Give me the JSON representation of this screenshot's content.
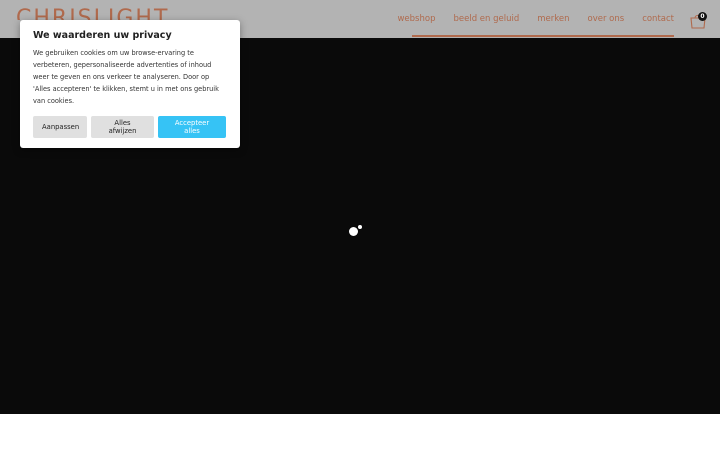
{
  "header": {
    "logo": "CHRISLIGHT",
    "nav": [
      "webshop",
      "beeld en geluid",
      "merken",
      "over ons",
      "contact"
    ],
    "cart_count": "0",
    "accent": "#b06a4d"
  },
  "consent": {
    "title": "We waarderen uw privacy",
    "text": "We gebruiken cookies om uw browse-ervaring te verbeteren, gepersonaliseerde advertenties of inhoud weer te geven en ons verkeer te analyseren. Door op 'Alles accepteren' te klikken, stemt u in met ons gebruik van cookies.",
    "customize_label": "Aanpassen",
    "reject_label": "Alles afwijzen",
    "accept_label": "Accepteer alles",
    "accept_color": "#36c3f5"
  },
  "hero": {
    "background": "#0a0a0a",
    "loading_icon": "loading-spinner-icon"
  }
}
